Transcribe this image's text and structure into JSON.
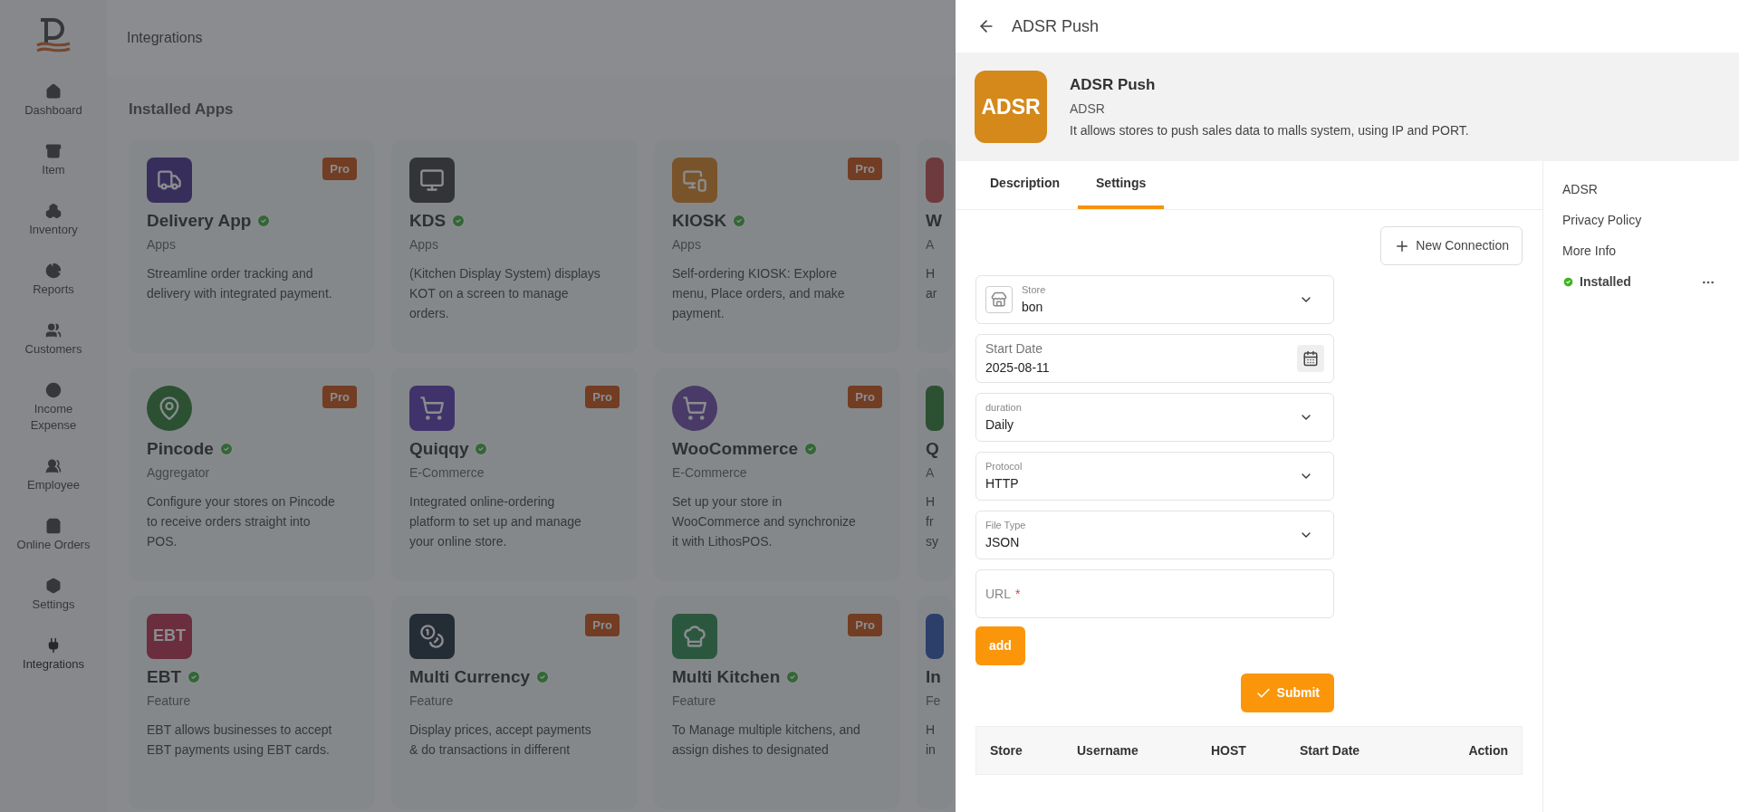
{
  "sidebar": {
    "items": [
      {
        "label": "Dashboard",
        "selected": false
      },
      {
        "label": "Item",
        "selected": false
      },
      {
        "label": "Inventory",
        "selected": false
      },
      {
        "label": "Reports",
        "selected": false
      },
      {
        "label": "Customers",
        "selected": false
      },
      {
        "label": "Income Expense",
        "selected": false
      },
      {
        "label": "Employee",
        "selected": false
      },
      {
        "label": "Online Orders",
        "selected": false
      },
      {
        "label": "Settings",
        "selected": false
      },
      {
        "label": "Integrations",
        "selected": true
      }
    ]
  },
  "page": {
    "title": "Integrations",
    "section_title": "Installed Apps",
    "app_rows": [
      [
        {
          "name": "Delivery App",
          "category": "Apps",
          "badge": "Pro",
          "verified": true,
          "description_lines": [
            "Streamline order tracking and",
            "delivery with integrated payment."
          ]
        },
        {
          "name": "KDS",
          "category": "Apps",
          "verified": true,
          "description_lines": [
            "(Kitchen Display System) displays",
            "KOT on a screen to manage",
            "orders."
          ]
        },
        {
          "name": "KIOSK",
          "category": "Apps",
          "badge": "Pro",
          "verified": true,
          "description_lines": [
            "Self-ordering KIOSK: Explore",
            "menu, Place orders, and make",
            "payment."
          ]
        },
        {
          "name": "W",
          "category": "A",
          "verified": false,
          "description_lines": [
            "H",
            "ar"
          ]
        }
      ],
      [
        {
          "name": "Pincode",
          "category": "Aggregator",
          "badge": "Pro",
          "verified": true,
          "description_lines": [
            "Configure your stores on Pincode",
            "to receive orders straight into",
            "POS."
          ]
        },
        {
          "name": "Quiqqy",
          "category": "E-Commerce",
          "badge": "Pro",
          "verified": true,
          "description_lines": [
            "Integrated online-ordering",
            "platform to set up and manage",
            "your online store."
          ]
        },
        {
          "name": "WooCommerce",
          "category": "E-Commerce",
          "badge": "Pro",
          "verified": true,
          "description_lines": [
            "Set up your store in",
            "WooCommerce and synchronize",
            "it with LithosPOS."
          ]
        },
        {
          "name": "Q",
          "category": "A",
          "verified": false,
          "description_lines": [
            "H",
            "fr",
            "sy"
          ]
        }
      ],
      [
        {
          "name": "EBT",
          "category": "Feature",
          "icon_text": "EBT",
          "verified": true,
          "description_lines": [
            "EBT allows businesses to accept",
            "EBT payments using EBT cards."
          ]
        },
        {
          "name": "Multi Currency",
          "category": "Feature",
          "badge": "Pro",
          "verified": true,
          "description_lines": [
            "Display prices, accept payments",
            "& do transactions in different"
          ]
        },
        {
          "name": "Multi Kitchen",
          "category": "Feature",
          "badge": "Pro",
          "verified": true,
          "description_lines": [
            "To Manage multiple kitchens, and",
            "assign dishes to designated"
          ]
        },
        {
          "name": "In",
          "category": "Fe",
          "verified": false,
          "description_lines": [
            "H",
            "in"
          ]
        }
      ]
    ]
  },
  "drawer": {
    "title": "ADSR Push",
    "app": {
      "logo_text": "ADSR",
      "name": "ADSR Push",
      "vendor": "ADSR",
      "description": "It allows stores to push sales data to malls system, using IP and PORT."
    },
    "tabs": [
      {
        "label": "Description",
        "selected": false
      },
      {
        "label": "Settings",
        "selected": true
      }
    ],
    "new_connection_button": "New Connection",
    "fields": [
      {
        "kind": "store",
        "label": "Store",
        "value": "bon"
      },
      {
        "kind": "date",
        "label": "Start Date",
        "value": "2025-08-11"
      },
      {
        "kind": "select",
        "label": "duration",
        "value": "Daily"
      },
      {
        "kind": "select",
        "label": "Protocol",
        "value": "HTTP"
      },
      {
        "kind": "select",
        "label": "File Type",
        "value": "JSON"
      },
      {
        "kind": "text",
        "placeholder": "URL",
        "required_mark": "*"
      }
    ],
    "add_button": "add",
    "submit_button": "Submit",
    "table": {
      "columns": [
        "Store",
        "Username",
        "HOST",
        "Start Date",
        "Action"
      ]
    },
    "links": [
      "ADSR",
      "Privacy Policy",
      "More Info"
    ],
    "status": {
      "label": "Installed",
      "installed": true
    }
  }
}
